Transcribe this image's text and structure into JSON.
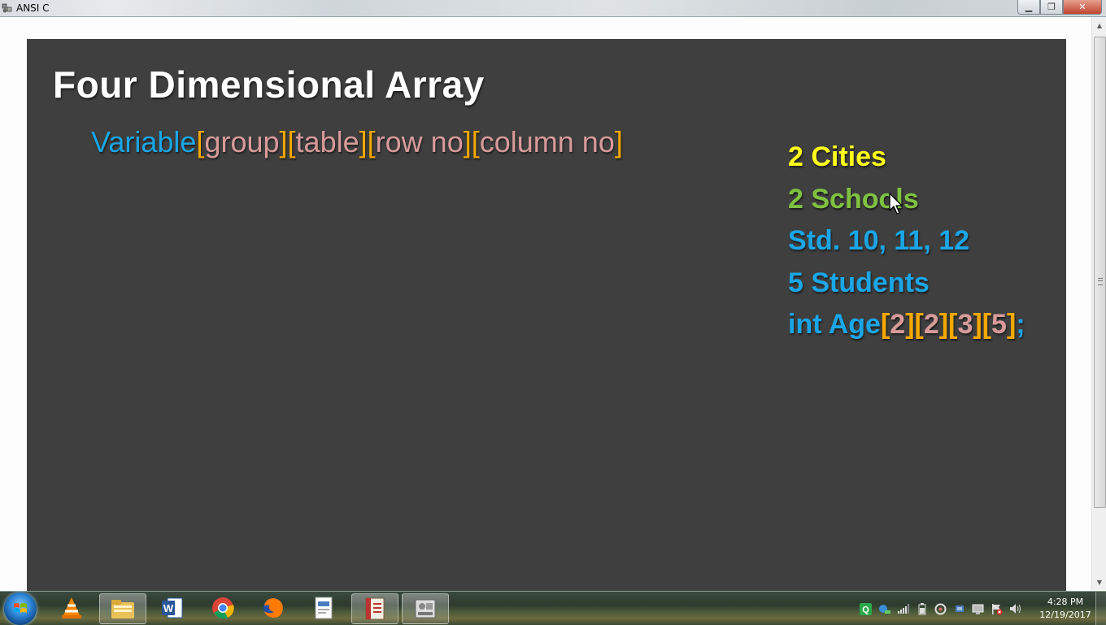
{
  "window": {
    "title": "ANSI C",
    "minimize_label": "▁",
    "restore_label": "❐",
    "close_label": "✕"
  },
  "slide": {
    "title": "Four Dimensional Array",
    "syntax": {
      "variable": "Variable",
      "open": "[",
      "close": "]",
      "dims": [
        "group",
        "table",
        "row no",
        "column no"
      ]
    },
    "info": {
      "cities": "2 Cities",
      "schools": "2 Schools",
      "std": "Std. 10, 11, 12",
      "students": "5 Students",
      "decl_prefix": "int Age",
      "decl_values": [
        "2",
        "2",
        "3",
        "5"
      ],
      "decl_end": ";"
    }
  },
  "colors": {
    "slide_bg": "#3f3f3f",
    "title": "#ffffff",
    "blue": "#1aa6e6",
    "orange": "#f5a800",
    "pink": "#d89a9a",
    "yellow": "#ffff1a",
    "green": "#7fc241"
  },
  "taskbar": {
    "items": [
      {
        "icon": "vlc-icon"
      },
      {
        "icon": "file-explorer-icon"
      },
      {
        "icon": "word-icon"
      },
      {
        "icon": "chrome-icon"
      },
      {
        "icon": "firefox-icon"
      },
      {
        "icon": "document-icon"
      },
      {
        "icon": "tally-erp-icon"
      },
      {
        "icon": "presentation-app-icon"
      }
    ],
    "tray_icons": [
      "qtranslate-icon",
      "network-share-icon",
      "signal-icon",
      "battery-icon",
      "sync-icon",
      "usb-icon",
      "monitor-icon",
      "flag-icon",
      "volume-icon"
    ],
    "time": "4:28 PM",
    "date": "12/19/2017"
  }
}
